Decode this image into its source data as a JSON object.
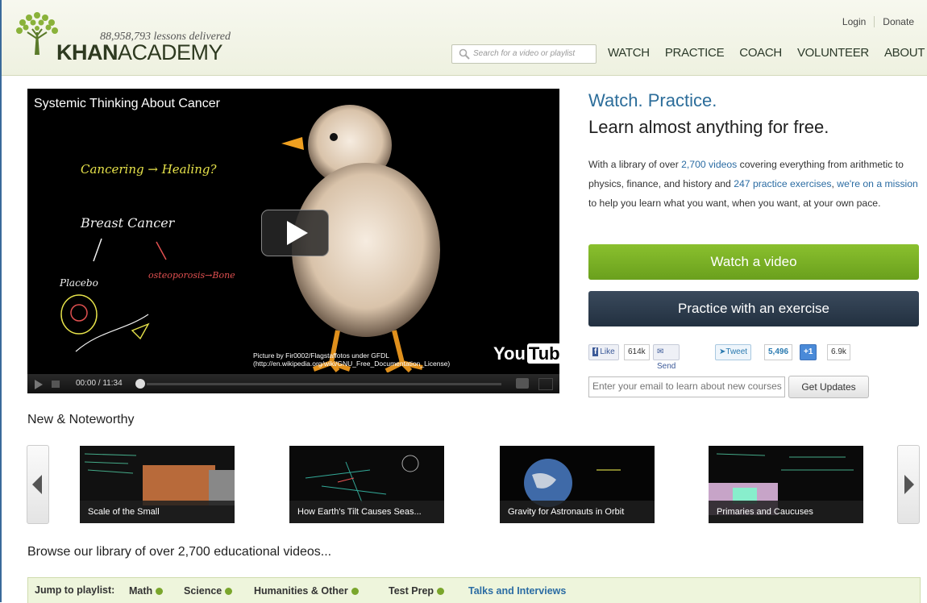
{
  "header": {
    "lessons_delivered": "88,958,793 lessons delivered",
    "logo_bold": "KHAN",
    "logo_light": "ACADEMY",
    "top_links": [
      "Login",
      "Donate"
    ],
    "search_placeholder": "Search for a video or playlist",
    "nav": [
      "WATCH",
      "PRACTICE",
      "COACH",
      "VOLUNTEER",
      "ABOUT"
    ]
  },
  "video": {
    "title": "Systemic Thinking About Cancer",
    "chalk": [
      "Cancering → Healing?",
      "Breast Cancer",
      "Placebo",
      "osteoporosis→Bone"
    ],
    "credit_line1": "Picture by Fir0002/Flagstaffotos under GFDL",
    "credit_line2": "(http://en.wikipedia.org/wiki/GNU_Free_Documentation_License)",
    "youtube": "You",
    "youtube_box": "Tube",
    "time": "00:00 / 11:34"
  },
  "hero": {
    "line1": "Watch. Practice.",
    "line2": "Learn almost anything for free.",
    "desc_a": "With a library of over ",
    "desc_link1": "2,700 videos",
    "desc_b": " covering everything from arithmetic to physics, finance, and history and ",
    "desc_link2": "247 practice exercises",
    "desc_c": ", ",
    "desc_link3": "we're on a mission",
    "desc_d": " to help you learn what you want, when you want, at your own pace.",
    "watch_btn": "Watch a video",
    "practice_btn": "Practice with an exercise"
  },
  "social": {
    "like": "Like",
    "like_count": "614k",
    "send": "Send",
    "tweet": "Tweet",
    "tweet_count": "5,496",
    "plus": "+1",
    "plus_count": "6.9k"
  },
  "updates": {
    "email_placeholder": "Enter your email to learn about new courses",
    "button": "Get Updates"
  },
  "noteworthy": {
    "title": "New & Noteworthy",
    "items": [
      "Scale of the Small",
      "How Earth's Tilt Causes Seas...",
      "Gravity for Astronauts in Orbit",
      "Primaries and Caucuses"
    ]
  },
  "browse": {
    "title": "Browse our library of over 2,700 educational videos...",
    "jump_label": "Jump to playlist:",
    "playlists": [
      "Math",
      "Science",
      "Humanities & Other",
      "Test Prep",
      "Talks and Interviews"
    ]
  },
  "colors": {
    "accent_blue": "#2c6d9a",
    "watch_green": "#7ab026",
    "practice_navy": "#2e3d4f"
  }
}
